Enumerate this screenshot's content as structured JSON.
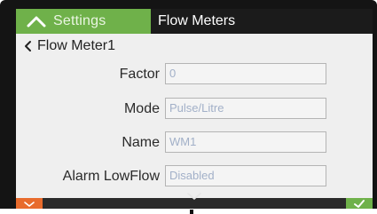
{
  "header": {
    "settings_tab": "Settings",
    "active_tab": "Flow Meters"
  },
  "back": {
    "label": "Flow Meter1"
  },
  "fields": [
    {
      "label": "Factor",
      "value": "0"
    },
    {
      "label": "Mode",
      "value": "Pulse/Litre"
    },
    {
      "label": "Name",
      "value": "WM1"
    },
    {
      "label": "Alarm LowFlow",
      "value": "Disabled"
    }
  ],
  "colors": {
    "accent_green": "#6fb14a",
    "accent_orange": "#e86b2c",
    "header_dark": "#1b1b1b",
    "screen_bg": "#efefef"
  },
  "icons": {
    "settings_tab": "chevron-up-icon",
    "back": "chevron-left-icon",
    "scroll": "chevron-down-icon",
    "cancel": "chevron-down-icon",
    "confirm": "checkmark-icon"
  }
}
